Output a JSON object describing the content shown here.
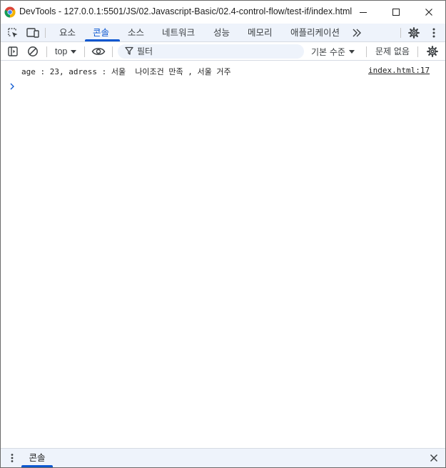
{
  "window": {
    "title": "DevTools - 127.0.0.1:5501/JS/02.Javascript-Basic/02.4-control-flow/test-if/index.html"
  },
  "tabs": [
    {
      "label": "요소"
    },
    {
      "label": "콘솔"
    },
    {
      "label": "소스"
    },
    {
      "label": "네트워크"
    },
    {
      "label": "성능"
    },
    {
      "label": "메모리"
    },
    {
      "label": "애플리케이션"
    }
  ],
  "active_tab": "콘솔",
  "toolbar": {
    "context": "top",
    "filter_placeholder": "필터",
    "level": "기본 수준",
    "issues": "문제 없음"
  },
  "console": {
    "messages": [
      {
        "text": "age : 23, adress : 서울  나이조건 만족 , 서울 거주",
        "source": "index.html:17"
      }
    ]
  },
  "drawer": {
    "tab": "콘솔"
  },
  "colors": {
    "accent": "#0b57d0",
    "tabbar_bg": "#eef3fb",
    "border": "#d6dbe3"
  }
}
